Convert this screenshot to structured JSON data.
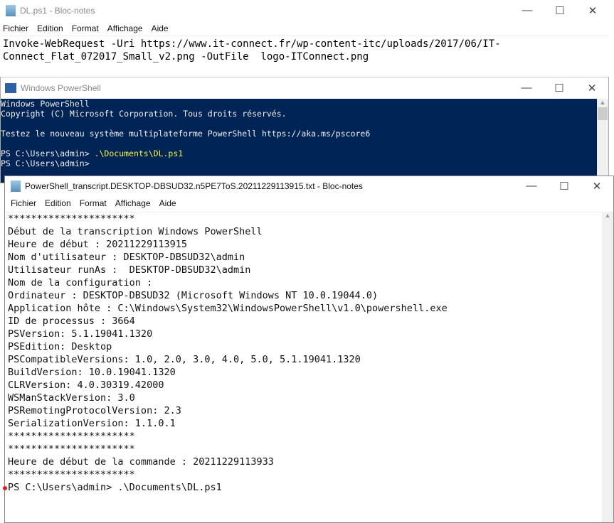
{
  "win1": {
    "title": "DL.ps1 - Bloc-notes",
    "menu": [
      "Fichier",
      "Edition",
      "Format",
      "Affichage",
      "Aide"
    ],
    "lines": [
      "Invoke-WebRequest -Uri https://www.it-connect.fr/wp-content-itc/uploads/2017/06/IT-",
      "Connect_Flat_072017_Small_v2.png -OutFile  logo-ITConnect.png"
    ]
  },
  "win2": {
    "title": "Windows PowerShell",
    "lines": [
      "Windows PowerShell",
      "Copyright (C) Microsoft Corporation. Tous droits réservés.",
      "",
      "Testez le nouveau système multiplateforme PowerShell https://aka.ms/pscore6",
      ""
    ],
    "prompt1": "PS C:\\Users\\admin> ",
    "cmd1": ".\\Documents\\DL.ps1",
    "prompt2": "PS C:\\Users\\admin>"
  },
  "win3": {
    "title": "PowerShell_transcript.DESKTOP-DBSUD32.n5PE7ToS.20211229113915.txt - Bloc-notes",
    "menu": [
      "Fichier",
      "Edition",
      "Format",
      "Affichage",
      "Aide"
    ],
    "lines": [
      "**********************",
      "Début de la transcription Windows PowerShell",
      "Heure de début : 20211229113915",
      "Nom d'utilisateur : DESKTOP-DBSUD32\\admin",
      "Utilisateur runAs :  DESKTOP-DBSUD32\\admin",
      "Nom de la configuration : ",
      "Ordinateur : DESKTOP-DBSUD32 (Microsoft Windows NT 10.0.19044.0)",
      "Application hôte : C:\\Windows\\System32\\WindowsPowerShell\\v1.0\\powershell.exe",
      "ID de processus : 3664",
      "PSVersion: 5.1.19041.1320",
      "PSEdition: Desktop",
      "PSCompatibleVersions: 1.0, 2.0, 3.0, 4.0, 5.0, 5.1.19041.1320",
      "BuildVersion: 10.0.19041.1320",
      "CLRVersion: 4.0.30319.42000",
      "WSManStackVersion: 3.0",
      "PSRemotingProtocolVersion: 2.3",
      "SerializationVersion: 1.1.0.1",
      "**********************",
      "**********************",
      "Heure de début de la commande : 20211229113933",
      "**********************",
      "PS C:\\Users\\admin> .\\Documents\\DL.ps1",
      ""
    ]
  },
  "controls": {
    "min": "—",
    "max": "☐",
    "close": "✕"
  }
}
